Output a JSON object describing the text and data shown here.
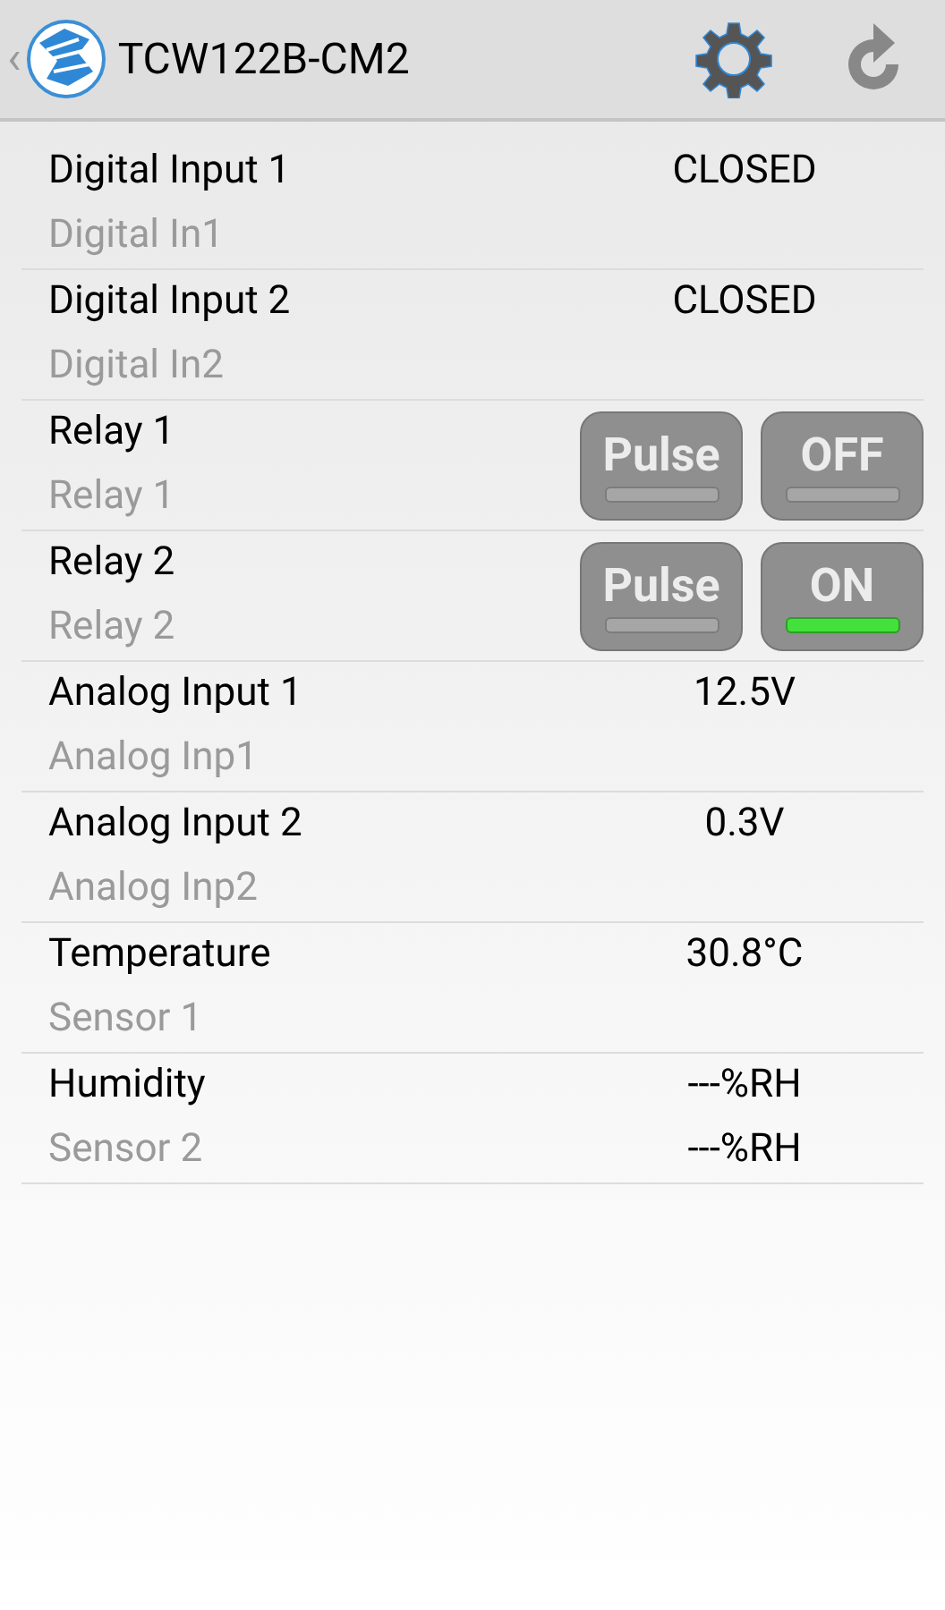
{
  "header": {
    "back": "‹",
    "title": "TCW122B-CM2"
  },
  "rows": [
    {
      "kind": "value",
      "name": "Digital Input 1",
      "sub": "Digital In1",
      "value": "CLOSED"
    },
    {
      "kind": "value",
      "name": "Digital Input 2",
      "sub": "Digital In2",
      "value": "CLOSED"
    },
    {
      "kind": "relay",
      "name": "Relay 1",
      "sub": "Relay 1",
      "pulse": "Pulse",
      "toggle": "OFF",
      "on": false
    },
    {
      "kind": "relay",
      "name": "Relay 2",
      "sub": "Relay 2",
      "pulse": "Pulse",
      "toggle": "ON",
      "on": true
    },
    {
      "kind": "value",
      "name": "Analog Input 1",
      "sub": "Analog Inp1",
      "value": "12.5V"
    },
    {
      "kind": "value",
      "name": "Analog Input 2",
      "sub": "Analog Inp2",
      "value": "0.3V"
    },
    {
      "kind": "value",
      "name": "Temperature",
      "sub": "Sensor 1",
      "value": "30.8°C"
    },
    {
      "kind": "value",
      "name": "Humidity",
      "sub": "Sensor 2",
      "value": "---%RH",
      "value_2": "---%RH"
    }
  ]
}
